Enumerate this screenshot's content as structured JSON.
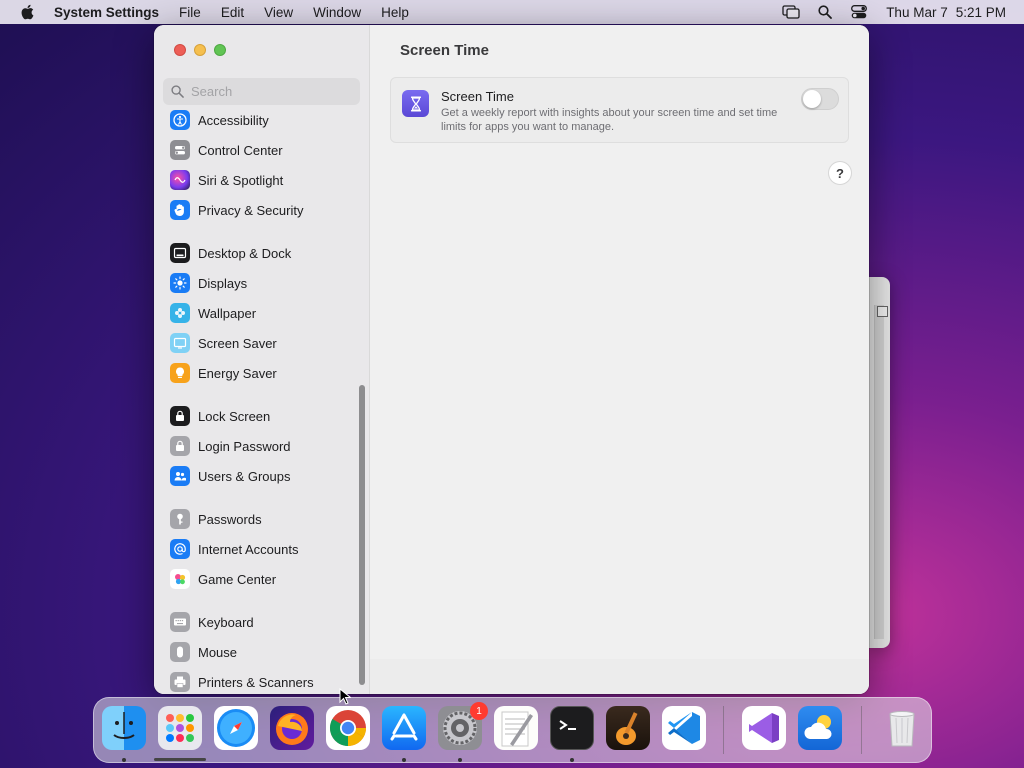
{
  "menubar": {
    "app_name": "System Settings",
    "menus": [
      "File",
      "Edit",
      "View",
      "Window",
      "Help"
    ],
    "date": "Thu Mar 7",
    "time": "5:21 PM"
  },
  "sidebar": {
    "search_placeholder": "Search",
    "items": [
      {
        "label": "Accessibility",
        "icon": "accessibility-icon",
        "color": "#1a7cf5"
      },
      {
        "label": "Control Center",
        "icon": "control-center-icon",
        "color": "#8e8e93"
      },
      {
        "label": "Siri & Spotlight",
        "icon": "siri-icon",
        "color": "#b23fd8"
      },
      {
        "label": "Privacy & Security",
        "icon": "hand-icon",
        "color": "#1a7cf5"
      },
      {
        "label": "Desktop & Dock",
        "icon": "desktop-dock-icon",
        "color": "#1c1c1e"
      },
      {
        "label": "Displays",
        "icon": "sun-icon",
        "color": "#1a7cf5"
      },
      {
        "label": "Wallpaper",
        "icon": "wallpaper-icon",
        "color": "#36b3e8"
      },
      {
        "label": "Screen Saver",
        "icon": "screen-saver-icon",
        "color": "#5ac8fa"
      },
      {
        "label": "Energy Saver",
        "icon": "lightbulb-icon",
        "color": "#f7a21b"
      },
      {
        "label": "Lock Screen",
        "icon": "lock-icon",
        "color": "#1c1c1e"
      },
      {
        "label": "Login Password",
        "icon": "padlock-icon",
        "color": "#8e8e93"
      },
      {
        "label": "Users & Groups",
        "icon": "users-icon",
        "color": "#1a7cf5"
      },
      {
        "label": "Passwords",
        "icon": "key-icon",
        "color": "#8e8e93"
      },
      {
        "label": "Internet Accounts",
        "icon": "at-icon",
        "color": "#1a7cf5"
      },
      {
        "label": "Game Center",
        "icon": "game-center-icon",
        "color": "#ffffff"
      },
      {
        "label": "Keyboard",
        "icon": "keyboard-icon",
        "color": "#8e8e93"
      },
      {
        "label": "Mouse",
        "icon": "mouse-icon",
        "color": "#8e8e93"
      },
      {
        "label": "Printers & Scanners",
        "icon": "printer-icon",
        "color": "#8e8e93"
      }
    ]
  },
  "main": {
    "title": "Screen Time",
    "card": {
      "title": "Screen Time",
      "description": "Get a weekly report with insights about your screen time and set time limits for apps you want to manage.",
      "toggle_on": false
    },
    "help_label": "?"
  },
  "dock": {
    "apps": [
      {
        "name": "Finder",
        "icon": "finder-icon",
        "running": true
      },
      {
        "name": "Launchpad",
        "icon": "launchpad-icon",
        "running": false
      },
      {
        "name": "Safari",
        "icon": "safari-icon",
        "running": false
      },
      {
        "name": "Firefox",
        "icon": "firefox-icon",
        "running": false
      },
      {
        "name": "Chrome",
        "icon": "chrome-icon",
        "running": false
      },
      {
        "name": "App Store",
        "icon": "app-store-icon",
        "running": true
      },
      {
        "name": "System Settings",
        "icon": "system-settings-icon",
        "running": true,
        "badge": "1"
      },
      {
        "name": "TextEdit",
        "icon": "textedit-icon",
        "running": false
      },
      {
        "name": "Terminal",
        "icon": "terminal-icon",
        "running": true
      },
      {
        "name": "GarageBand",
        "icon": "garageband-icon",
        "running": false
      },
      {
        "name": "VS Code",
        "icon": "vscode-icon",
        "running": false
      },
      {
        "name": "Visual Studio",
        "icon": "visual-studio-icon",
        "running": false
      },
      {
        "name": "Weather",
        "icon": "weather-icon",
        "running": false
      },
      {
        "name": "Trash",
        "icon": "trash-icon",
        "running": false
      }
    ]
  }
}
